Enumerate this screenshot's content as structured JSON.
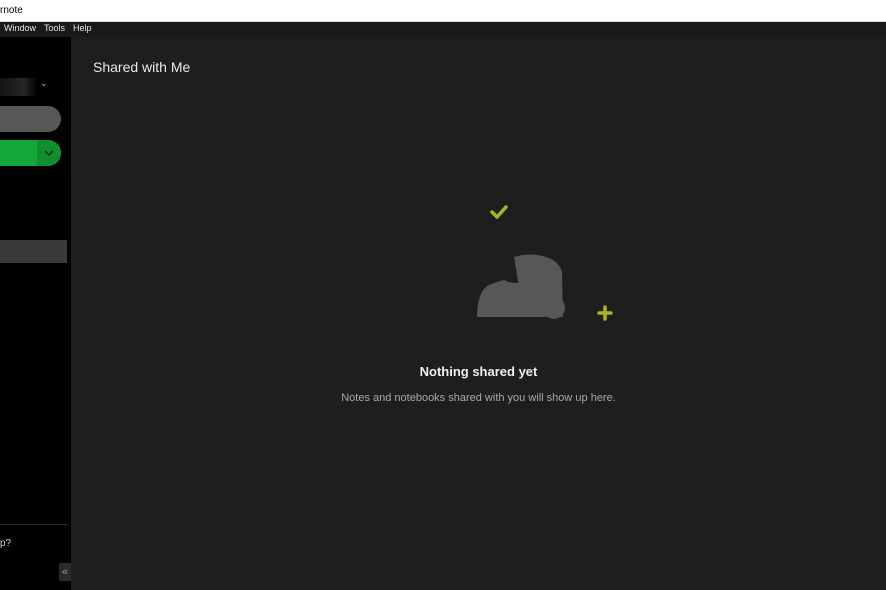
{
  "window": {
    "title": "rnote"
  },
  "menu": {
    "items": [
      "Window",
      "Tools",
      "Help"
    ]
  },
  "sidebar": {
    "help_label": "p?",
    "collapse_glyph": "«",
    "new_note_accent": "#14a73b"
  },
  "main": {
    "title": "Shared with Me",
    "empty_state": {
      "heading": "Nothing shared yet",
      "description": "Notes and notebooks shared with you will show up here."
    }
  },
  "colors": {
    "background": "#1e1e1e",
    "sidebar": "#000000",
    "accent_green": "#14a73b",
    "accent_olive": "#a9b51d"
  },
  "icons": [
    "chevron-down-icon",
    "chevron-down-icon",
    "collapse-sidebar-icon",
    "shared-people-icon",
    "checkmark-icon",
    "plus-icon",
    "arrow-up-icon"
  ]
}
